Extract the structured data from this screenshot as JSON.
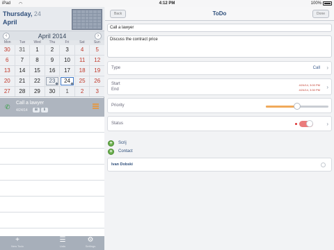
{
  "status_bar": {
    "carrier": "iPad",
    "time": "4:12 PM",
    "battery": "100%"
  },
  "date_header": {
    "weekday": "Thursday,",
    "day": "24",
    "month": "April"
  },
  "calendar": {
    "month_title": "April 2014",
    "weekdays": [
      "Mon",
      "Tue",
      "Wed",
      "Thu",
      "Fri",
      "Sat",
      "Sun"
    ],
    "days": [
      {
        "d": "30",
        "other": true,
        "wk": true
      },
      {
        "d": "31",
        "other": true
      },
      {
        "d": "1"
      },
      {
        "d": "2"
      },
      {
        "d": "3"
      },
      {
        "d": "4",
        "wk": true
      },
      {
        "d": "5",
        "wk": true
      },
      {
        "d": "6",
        "wk": true
      },
      {
        "d": "7"
      },
      {
        "d": "8"
      },
      {
        "d": "9"
      },
      {
        "d": "10"
      },
      {
        "d": "11",
        "wk": true
      },
      {
        "d": "12",
        "wk": true
      },
      {
        "d": "13",
        "wk": true
      },
      {
        "d": "14"
      },
      {
        "d": "15"
      },
      {
        "d": "16"
      },
      {
        "d": "17"
      },
      {
        "d": "18",
        "wk": true
      },
      {
        "d": "19",
        "wk": true
      },
      {
        "d": "20",
        "wk": true
      },
      {
        "d": "21"
      },
      {
        "d": "22"
      },
      {
        "d": "23",
        "sel": true,
        "mark": true
      },
      {
        "d": "24",
        "today": true,
        "mark": true
      },
      {
        "d": "25",
        "wk": true
      },
      {
        "d": "26",
        "wk": true
      },
      {
        "d": "27",
        "wk": true
      },
      {
        "d": "28"
      },
      {
        "d": "29"
      },
      {
        "d": "30"
      },
      {
        "d": "1",
        "other": true
      },
      {
        "d": "2",
        "other": true,
        "wk": true
      },
      {
        "d": "3",
        "other": true,
        "wk": true
      }
    ]
  },
  "event": {
    "title": "Call a lawyer",
    "sub": "4/24/14"
  },
  "toolbar": [
    {
      "icon": "+",
      "label": "New Todo",
      "name": "new-todo-button"
    },
    {
      "icon": "☰",
      "label": "Lists",
      "name": "lists-button"
    },
    {
      "icon": "⚙",
      "label": "Settings",
      "name": "settings-button"
    }
  ],
  "detail": {
    "nav_title": "ToDo",
    "back_label": "Back",
    "done_label": "Done",
    "title_field": "Call a lawyer",
    "notes_field": "Discuss the contract price",
    "type_label": "Type",
    "type_value": "Call",
    "start_label": "Start",
    "end_label": "End",
    "start_value": "4/24/14, 3:00 PM",
    "end_value": "4/24/14, 3:30 PM",
    "priority_label": "Priority",
    "priority_level": 0.5,
    "status_label": "Status",
    "add_1": "Scrij",
    "add_2": "Contact",
    "contact_name": "Ivan Dobski"
  }
}
